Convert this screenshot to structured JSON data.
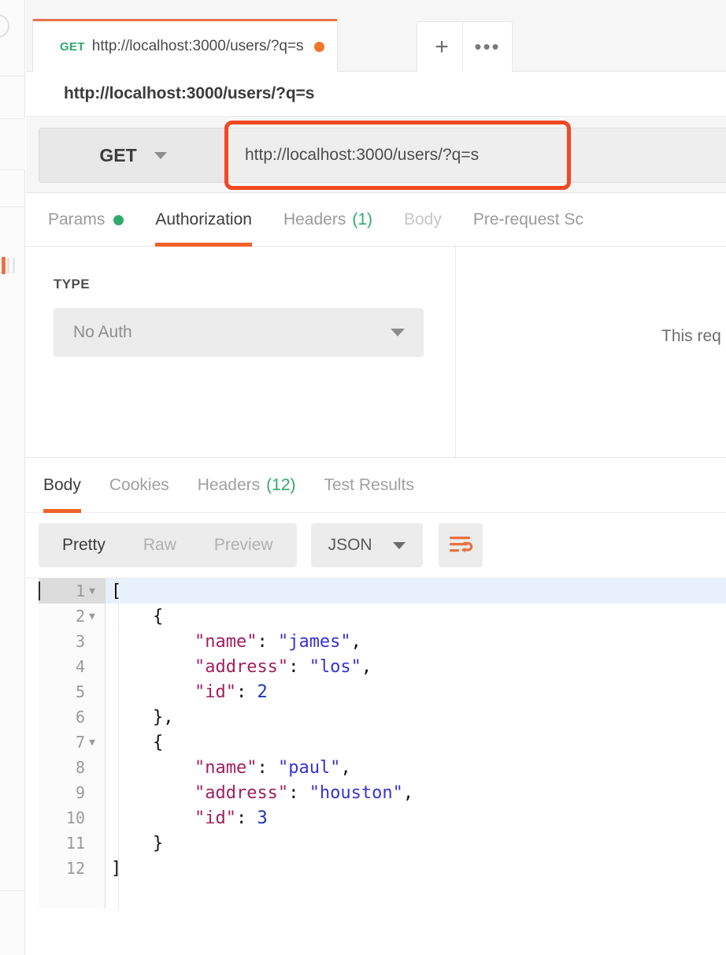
{
  "sidebar": {
    "icons": [
      "circle-outline-icon",
      "collection-bar-orange",
      "collection-bar-pink",
      "collection-bar-blue"
    ]
  },
  "tabstrip": {
    "active_tab": {
      "method": "GET",
      "name": "http://localhost:3000/users/?q=s",
      "unsaved": true
    },
    "new_tab_label": "+",
    "more_label": "•••"
  },
  "request": {
    "title": "http://localhost:3000/users/?q=s",
    "method": "GET",
    "url": "http://localhost:3000/users/?q=s",
    "tabs": [
      {
        "label": "Params",
        "badge": "dot",
        "state": "inactive"
      },
      {
        "label": "Authorization",
        "badge": "",
        "state": "active"
      },
      {
        "label": "Headers",
        "badge": "(1)",
        "state": "inactive"
      },
      {
        "label": "Body",
        "badge": "",
        "state": "dim"
      },
      {
        "label": "Pre-request Sc",
        "badge": "",
        "state": "inactive"
      }
    ],
    "auth": {
      "type_label": "TYPE",
      "type_value": "No Auth",
      "note": "This req"
    }
  },
  "response": {
    "tabs": [
      {
        "label": "Body",
        "badge": "",
        "state": "active"
      },
      {
        "label": "Cookies",
        "badge": "",
        "state": "inactive"
      },
      {
        "label": "Headers",
        "badge": "(12)",
        "state": "inactive"
      },
      {
        "label": "Test Results",
        "badge": "",
        "state": "inactive"
      }
    ],
    "viewer": {
      "modes": [
        {
          "label": "Pretty",
          "state": "active"
        },
        {
          "label": "Raw",
          "state": "inactive"
        },
        {
          "label": "Preview",
          "state": "inactive"
        }
      ],
      "format": "JSON",
      "wrap_icon": "word-wrap-icon"
    },
    "body_lines": [
      {
        "n": "1",
        "fold": true,
        "active": true,
        "tokens": [
          {
            "t": "[",
            "c": "p"
          }
        ]
      },
      {
        "n": "2",
        "fold": true,
        "active": false,
        "tokens": [
          {
            "t": "    {",
            "c": "p"
          }
        ]
      },
      {
        "n": "3",
        "fold": false,
        "active": false,
        "tokens": [
          {
            "t": "        ",
            "c": "p"
          },
          {
            "t": "\"name\"",
            "c": "k"
          },
          {
            "t": ": ",
            "c": "p"
          },
          {
            "t": "\"james\"",
            "c": "s"
          },
          {
            "t": ",",
            "c": "p"
          }
        ]
      },
      {
        "n": "4",
        "fold": false,
        "active": false,
        "tokens": [
          {
            "t": "        ",
            "c": "p"
          },
          {
            "t": "\"address\"",
            "c": "k"
          },
          {
            "t": ": ",
            "c": "p"
          },
          {
            "t": "\"los\"",
            "c": "s"
          },
          {
            "t": ",",
            "c": "p"
          }
        ]
      },
      {
        "n": "5",
        "fold": false,
        "active": false,
        "tokens": [
          {
            "t": "        ",
            "c": "p"
          },
          {
            "t": "\"id\"",
            "c": "k"
          },
          {
            "t": ": ",
            "c": "p"
          },
          {
            "t": "2",
            "c": "n"
          }
        ]
      },
      {
        "n": "6",
        "fold": false,
        "active": false,
        "tokens": [
          {
            "t": "    },",
            "c": "p"
          }
        ]
      },
      {
        "n": "7",
        "fold": true,
        "active": false,
        "tokens": [
          {
            "t": "    {",
            "c": "p"
          }
        ]
      },
      {
        "n": "8",
        "fold": false,
        "active": false,
        "tokens": [
          {
            "t": "        ",
            "c": "p"
          },
          {
            "t": "\"name\"",
            "c": "k"
          },
          {
            "t": ": ",
            "c": "p"
          },
          {
            "t": "\"paul\"",
            "c": "s"
          },
          {
            "t": ",",
            "c": "p"
          }
        ]
      },
      {
        "n": "9",
        "fold": false,
        "active": false,
        "tokens": [
          {
            "t": "        ",
            "c": "p"
          },
          {
            "t": "\"address\"",
            "c": "k"
          },
          {
            "t": ": ",
            "c": "p"
          },
          {
            "t": "\"houston\"",
            "c": "s"
          },
          {
            "t": ",",
            "c": "p"
          }
        ]
      },
      {
        "n": "10",
        "fold": false,
        "active": false,
        "tokens": [
          {
            "t": "        ",
            "c": "p"
          },
          {
            "t": "\"id\"",
            "c": "k"
          },
          {
            "t": ": ",
            "c": "p"
          },
          {
            "t": "3",
            "c": "n"
          }
        ]
      },
      {
        "n": "11",
        "fold": false,
        "active": false,
        "tokens": [
          {
            "t": "    }",
            "c": "p"
          }
        ]
      },
      {
        "n": "12",
        "fold": false,
        "active": false,
        "tokens": [
          {
            "t": "]",
            "c": "p"
          }
        ]
      }
    ]
  },
  "colors": {
    "accent_orange": "#f0622a",
    "method_green": "#2eab6b",
    "unsaved_dot": "#f0762a",
    "highlight_red": "#f24822",
    "json_key": "#a11f5e",
    "json_string": "#3633d1",
    "json_number": "#1b35b8"
  }
}
